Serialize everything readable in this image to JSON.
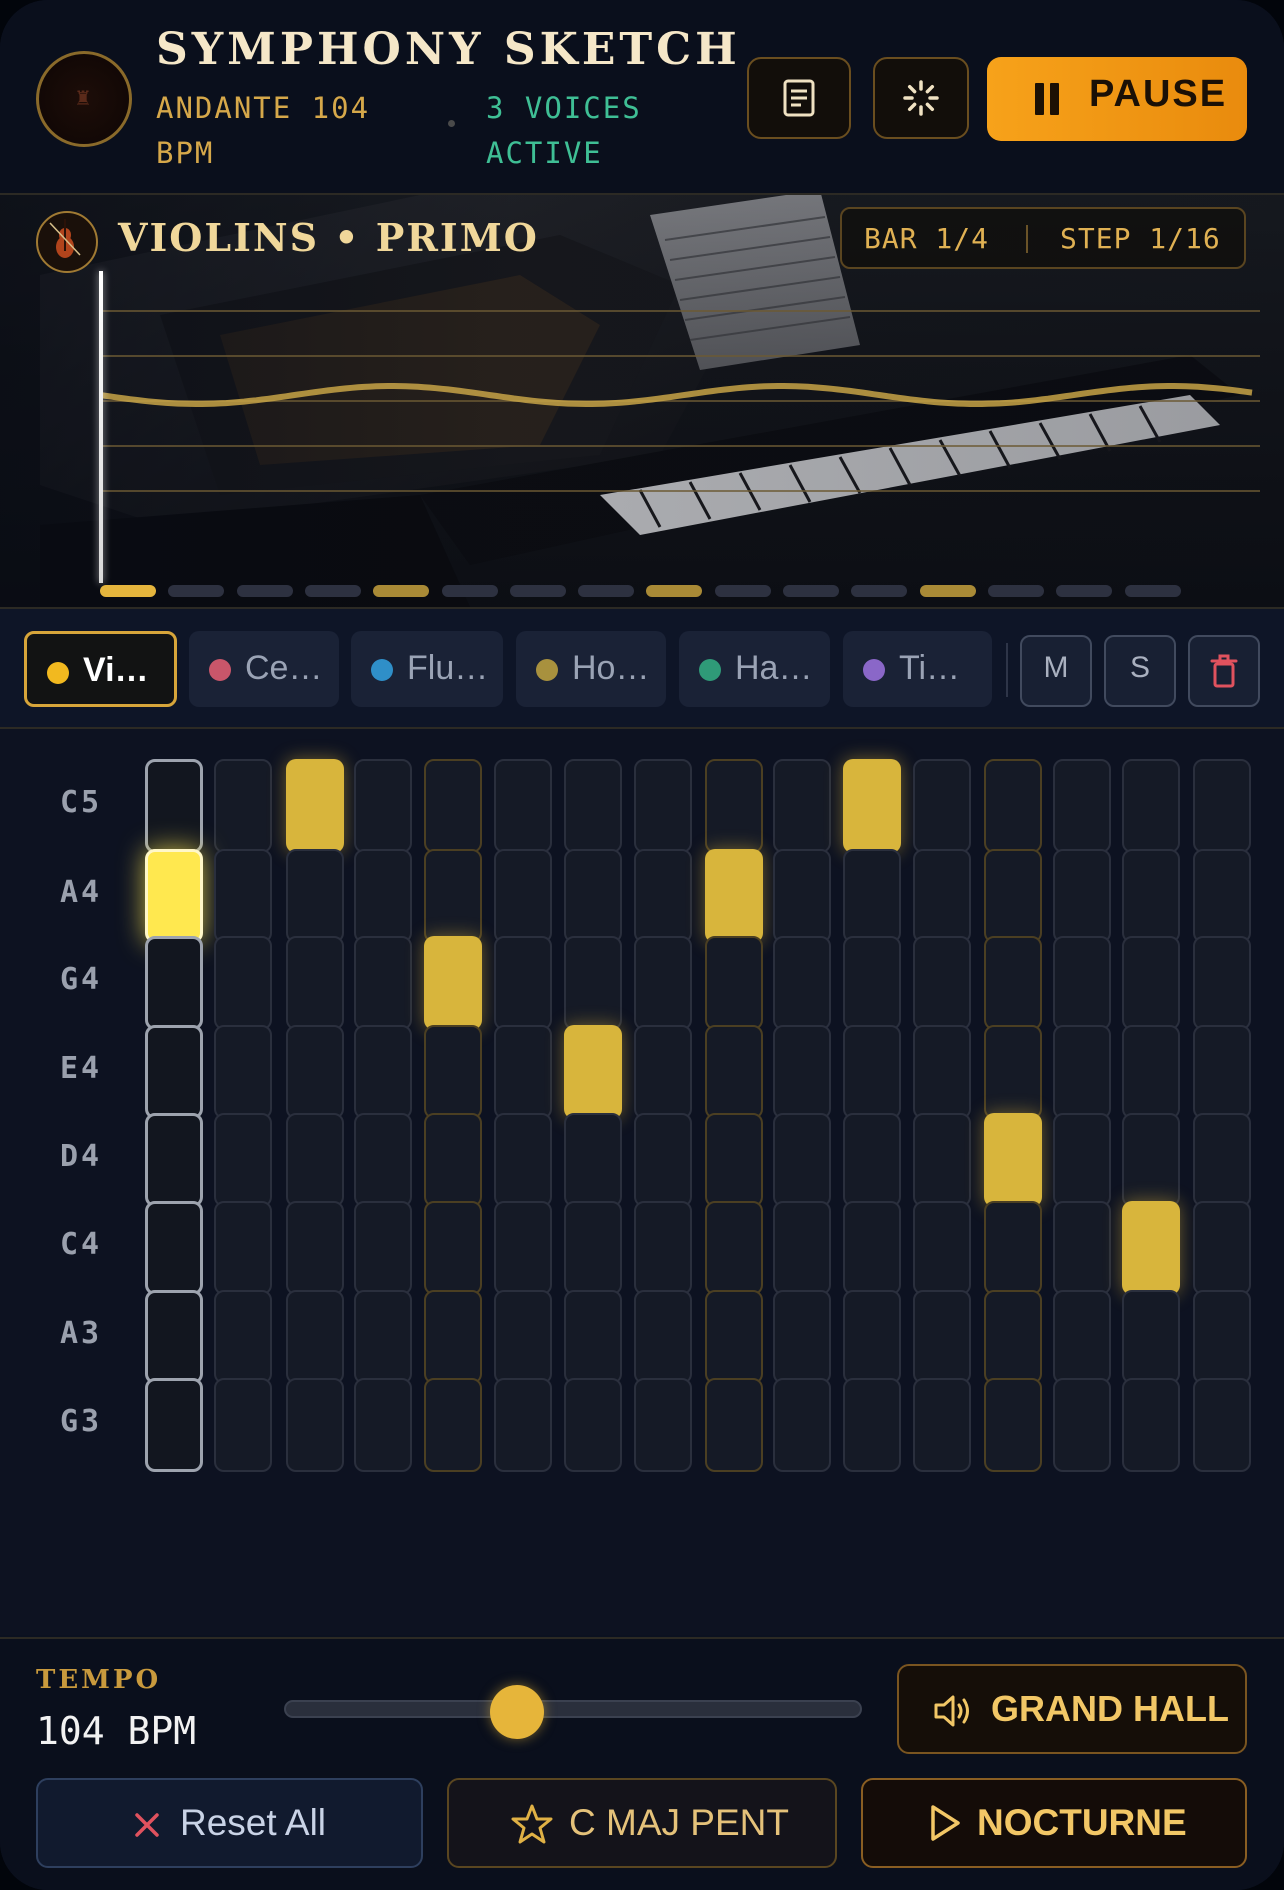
{
  "header": {
    "title": "SYMPHONY SKETCH",
    "tempo_line": "ANDANTE 104 BPM",
    "voices_line": "3 VOICES ACTIVE",
    "pause_label": "PAUSE"
  },
  "stage": {
    "instrument_title": "VIOLINS • PRIMO",
    "bar": "BAR 1/4",
    "step": "STEP 1/16",
    "current_step": 1,
    "total_steps": 16
  },
  "voices": [
    {
      "label": "Vi…",
      "color": "#f2b91f",
      "active": true
    },
    {
      "label": "Ce…",
      "color": "#c9566a",
      "active": false
    },
    {
      "label": "Flu…",
      "color": "#2f8fc8",
      "active": false
    },
    {
      "label": "Ho…",
      "color": "#a8913e",
      "active": false
    },
    {
      "label": "Ha…",
      "color": "#2f9a78",
      "active": false
    },
    {
      "label": "Ti…",
      "color": "#8a67c8",
      "active": false
    }
  ],
  "controls": {
    "mute": "M",
    "solo": "S"
  },
  "grid": {
    "notes": [
      "C5",
      "A4",
      "G4",
      "E4",
      "D4",
      "C4",
      "A3",
      "G3"
    ],
    "active_cells": [
      [
        0,
        2
      ],
      [
        0,
        10
      ],
      [
        1,
        0
      ],
      [
        1,
        8
      ],
      [
        2,
        4
      ],
      [
        3,
        6
      ],
      [
        4,
        12
      ],
      [
        5,
        14
      ]
    ],
    "playing_cell": [
      1,
      0
    ],
    "active_steps": [
      0,
      4,
      8,
      12
    ]
  },
  "footer": {
    "tempo_label": "TEMPO",
    "tempo_value": "104 BPM",
    "tempo_level": 0.4,
    "hall_label": "GRAND HALL",
    "reset_label": "Reset All",
    "scale_label": "C MAJ PENT",
    "nocturne_label": "NOCTURNE"
  },
  "colors": {
    "accent": "#f4a017",
    "gold": "#d8b53c",
    "bg": "#0b1120"
  }
}
